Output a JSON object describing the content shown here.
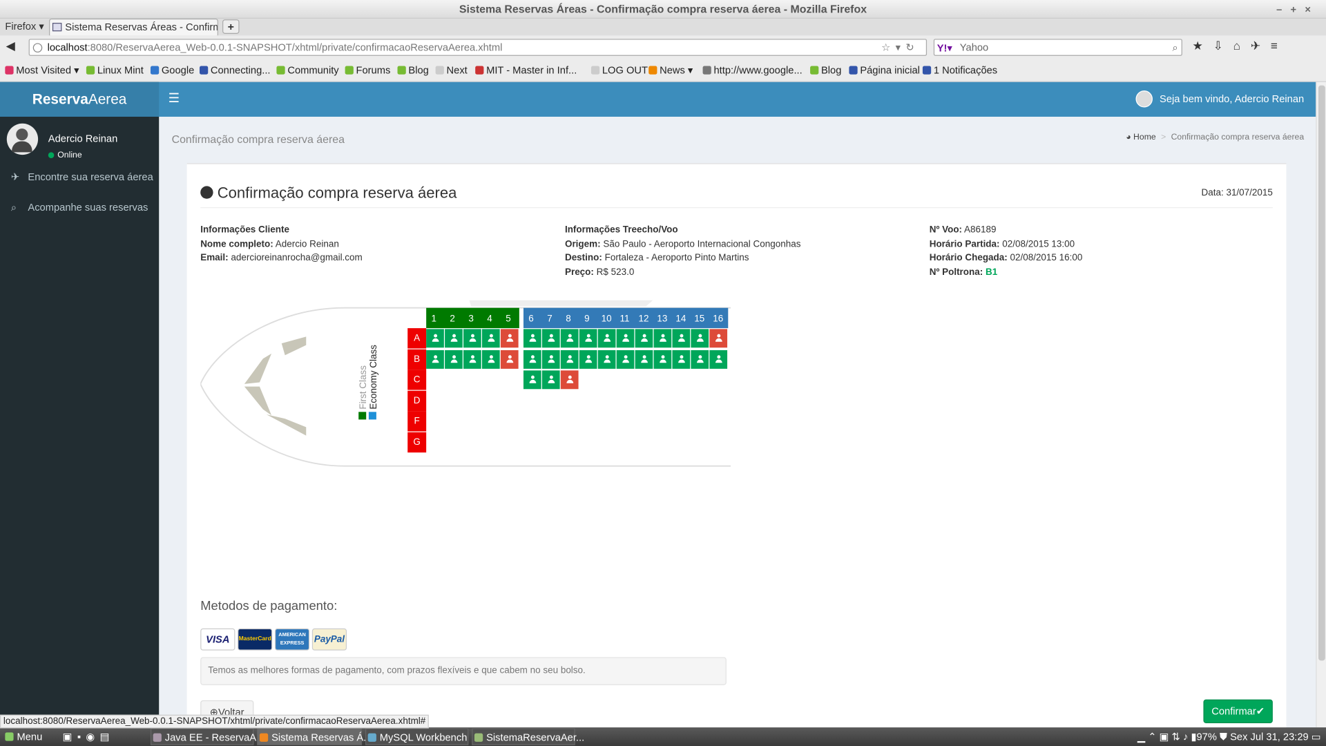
{
  "window": {
    "title": "Sistema Reservas Áreas - Confirmação compra reserva áerea - Mozilla Firefox"
  },
  "browser": {
    "menu": "Firefox ▾",
    "tab_title": "Sistema Reservas Áreas - Confirma...",
    "url_host": "localhost",
    "url_path": ":8080/ReservaAerea_Web-0.0.1-SNAPSHOT/xhtml/private/confirmacaoReservaAerea.xhtml",
    "search_placeholder": "Yahoo",
    "bookmarks": [
      "Most Visited ▾",
      "Linux Mint",
      "Google",
      "Connecting...",
      "Community",
      "Forums",
      "Blog",
      "Next",
      "MIT - Master in Inf...",
      "LOG OUT",
      "News ▾",
      "http://www.google...",
      "Blog",
      "Página inicial",
      "1 Notificações"
    ],
    "status_url": "localhost:8080/ReservaAerea_Web-0.0.1-SNAPSHOT/xhtml/private/confirmacaoReservaAerea.xhtml#"
  },
  "app": {
    "logo_bold": "Reserva",
    "logo_light": "Aerea",
    "welcome": "Seja bem vindo, Adercio Reinan",
    "user": {
      "name": "Adercio Reinan",
      "status": "Online"
    },
    "sidebar": [
      {
        "label": "Encontre sua reserva áerea",
        "icon": "plane-icon"
      },
      {
        "label": "Acompanhe suas reservas",
        "icon": "search-icon"
      }
    ],
    "page_title": "Confirmação compra reserva áerea",
    "breadcrumb": {
      "home": "Home",
      "current": "Confirmação compra reserva áerea"
    }
  },
  "invoice": {
    "title": "Confirmação compra reserva áerea",
    "date": "Data: 31/07/2015",
    "cliente": {
      "heading": "Informações Cliente",
      "nome_label": "Nome completo:",
      "nome": "Adercio Reinan",
      "email_label": "Email:",
      "email": "adercioreinanrocha@gmail.com"
    },
    "voo": {
      "heading": "Informações Treecho/Voo",
      "origem_label": "Origem:",
      "origem": "São Paulo - Aeroporto Internacional Congonhas",
      "destino_label": "Destino:",
      "destino": "Fortaleza - Aeroporto Pinto Martins",
      "preco_label": "Preço:",
      "preco": "R$ 523.0"
    },
    "detalhes": {
      "voo_label": "Nº Voo:",
      "voo": "A86189",
      "partida_label": "Horário Partida:",
      "partida": "02/08/2015 13:00",
      "chegada_label": "Horário Chegada:",
      "chegada": "02/08/2015 16:00",
      "poltrona_label": "Nº Poltrona:",
      "poltrona": "B1"
    }
  },
  "seatmap": {
    "legend": {
      "first": "First Class",
      "economy": "Economy Class"
    },
    "first_cols": [
      "1",
      "2",
      "3",
      "4",
      "5"
    ],
    "economy_cols": [
      "6",
      "7",
      "8",
      "9",
      "10",
      "11",
      "12",
      "13",
      "14",
      "15",
      "16"
    ],
    "rows": [
      "A",
      "B",
      "C",
      "D",
      "F",
      "G"
    ],
    "colors": {
      "first": "#007a00",
      "economy": "#337ab7",
      "available": "#00a65a",
      "occupied": "#dd4b39",
      "row": "#ee0000"
    },
    "occupied": [
      "A5",
      "A16",
      "B5",
      "C8"
    ],
    "row_c_cols": [
      "6",
      "7",
      "8"
    ]
  },
  "payment": {
    "heading": "Metodos de pagamento:",
    "cards": [
      "VISA",
      "MasterCard",
      "AMERICAN EXPRESS",
      "PayPal"
    ],
    "note": "Temos as melhores formas de pagamento, com prazos flexíveis e que cabem no seu bolso.",
    "back": "Voltar",
    "confirm": "Confirmar✔"
  },
  "taskbar": {
    "menu": "Menu",
    "items": [
      "Java EE - ReservaA...",
      "Sistema Reservas Á...",
      "MySQL Workbench",
      "SistemaReservaAer..."
    ],
    "battery": "97%",
    "clock": "Sex Jul 31, 23:29"
  }
}
